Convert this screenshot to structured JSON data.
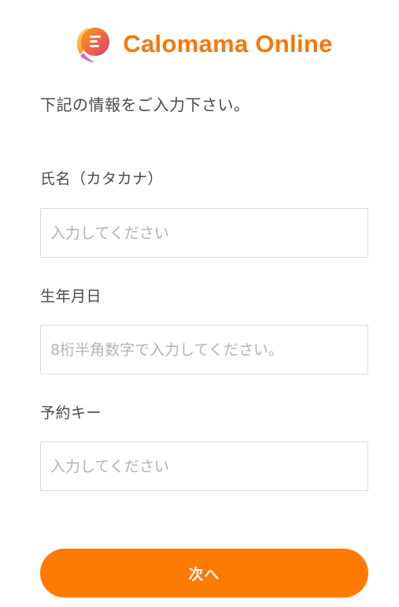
{
  "header": {
    "app_title": "Calomama Online",
    "logo_icon": "calomama-logo-icon",
    "brand_color": "#f5780a"
  },
  "instruction": "下記の情報をご入力下さい。",
  "form": {
    "fields": [
      {
        "label": "氏名（カタカナ）",
        "value": "",
        "placeholder": "入力してください"
      },
      {
        "label": "生年月日",
        "value": "",
        "placeholder": "8桁半角数字で入力してください。"
      },
      {
        "label": "予約キー",
        "value": "",
        "placeholder": "入力してください"
      }
    ],
    "submit_label": "次へ",
    "submit_color": "#ff7a00"
  }
}
